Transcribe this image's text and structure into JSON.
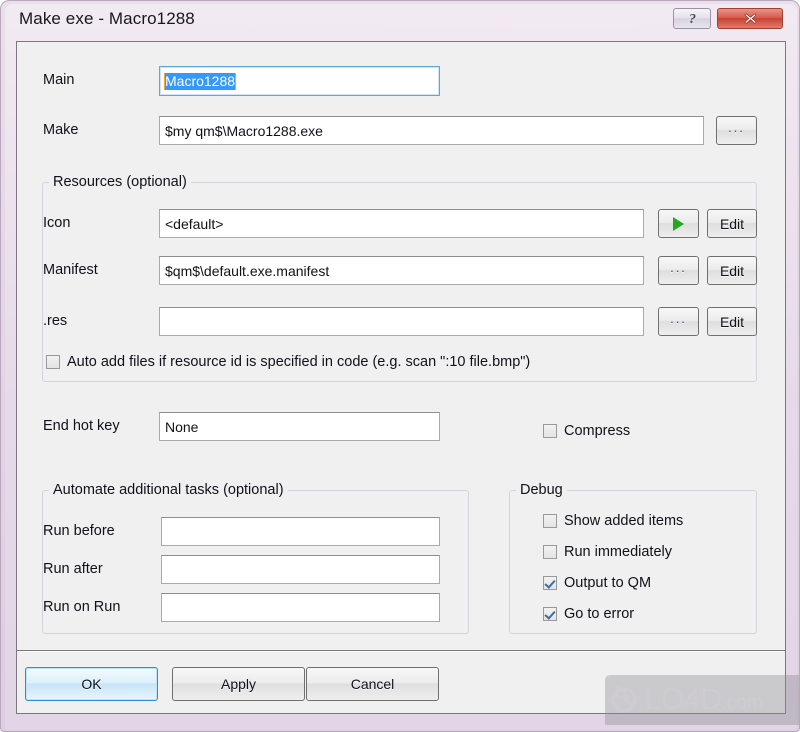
{
  "window": {
    "title": "Make exe - Macro1288",
    "help_button": "?",
    "close_button": "✕",
    "accent_close": "#c84334",
    "accent_focus": "#5ba7e0",
    "accent_selection": "#3399ff"
  },
  "main_row": {
    "label": "Main",
    "value": "Macro1288",
    "selected": true
  },
  "make_row": {
    "label": "Make",
    "value": "$my qm$\\Macro1288.exe",
    "browse_button": "..."
  },
  "resources": {
    "title": "Resources (optional)",
    "rows": [
      {
        "label": "Icon",
        "value": "<default>",
        "action": "play",
        "edit": "Edit"
      },
      {
        "label": "Manifest",
        "value": "$qm$\\default.exe.manifest",
        "action": "...",
        "edit": "Edit"
      },
      {
        "label": ".res",
        "value": "",
        "action": "...",
        "edit": "Edit"
      }
    ],
    "auto_add": {
      "label": "Auto add files if resource id is specified in code (e.g. scan \":10 file.bmp\")",
      "checked": false
    }
  },
  "hotkey": {
    "label": "End hot key",
    "value": "None"
  },
  "compress": {
    "label": "Compress",
    "checked": false
  },
  "automate": {
    "title": "Automate additional tasks (optional)",
    "rows": [
      {
        "label": "Run before",
        "value": ""
      },
      {
        "label": "Run after",
        "value": ""
      },
      {
        "label": "Run on Run",
        "value": ""
      }
    ]
  },
  "debug": {
    "title": "Debug",
    "items": [
      {
        "label": "Show added items",
        "checked": false
      },
      {
        "label": "Run immediately",
        "checked": false
      },
      {
        "label": "Output to QM",
        "checked": true
      },
      {
        "label": "Go to error",
        "checked": true
      }
    ]
  },
  "footer": {
    "ok": "OK",
    "apply": "Apply",
    "cancel": "Cancel"
  },
  "watermark": {
    "name": "LO4D",
    "suffix": ".com"
  }
}
